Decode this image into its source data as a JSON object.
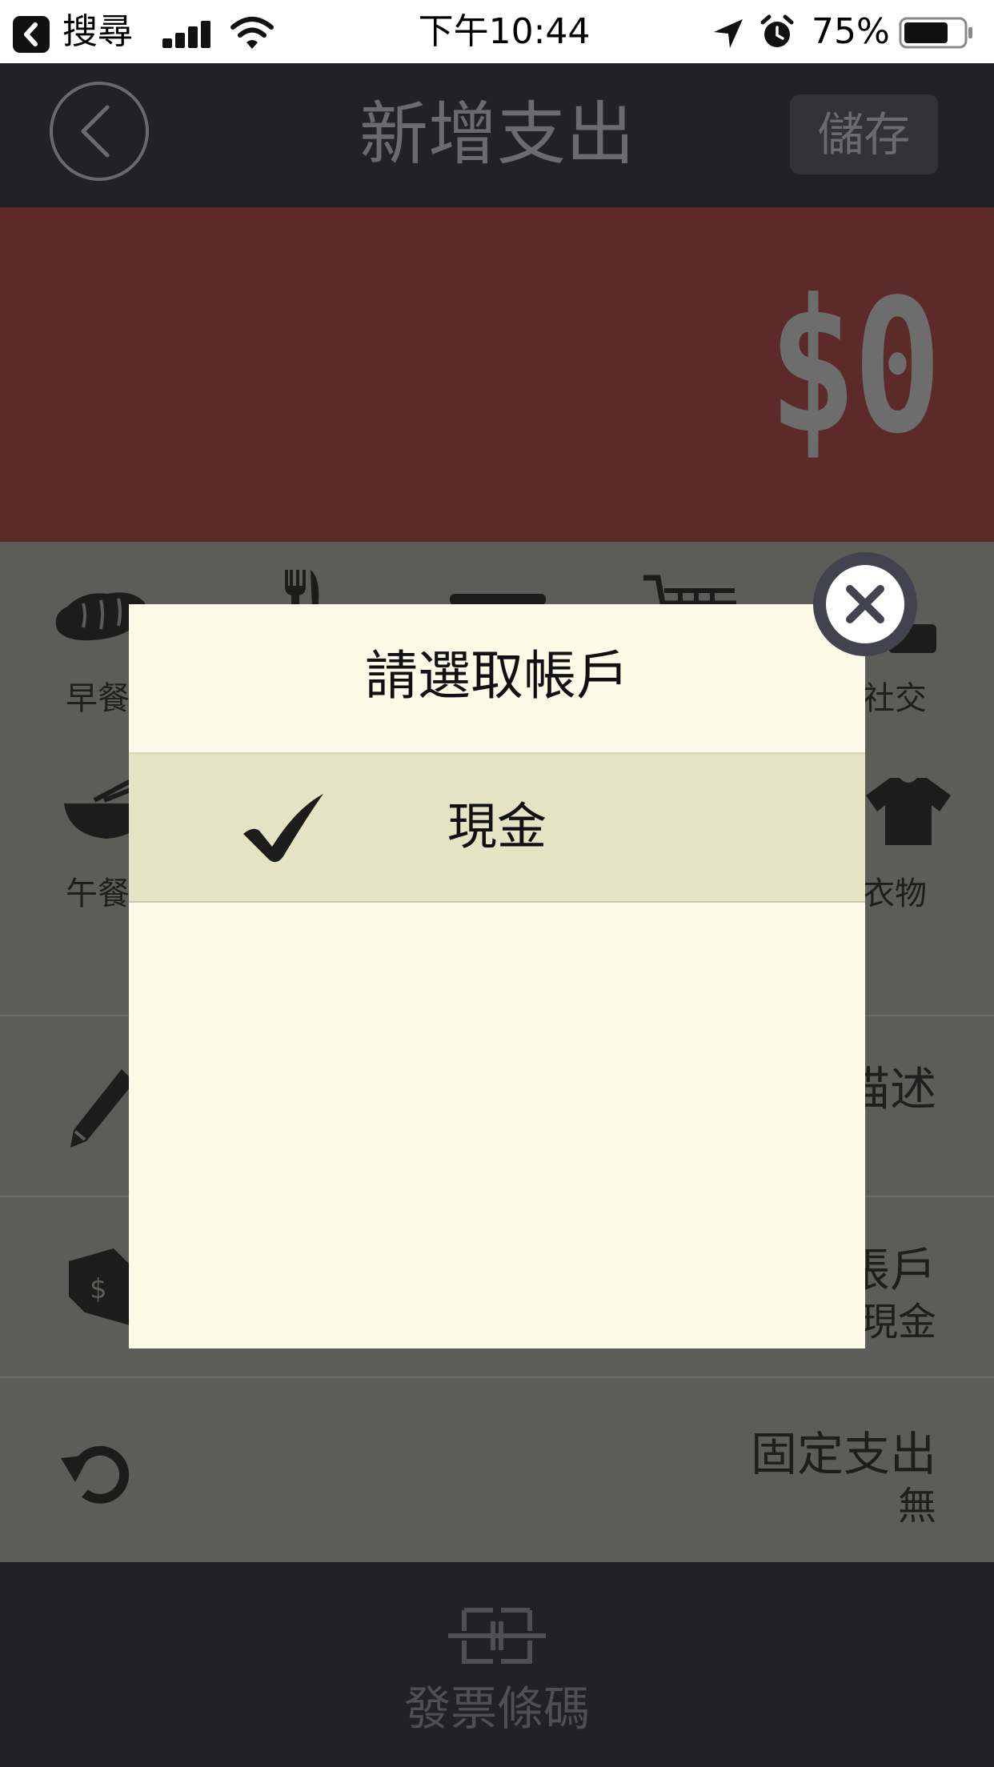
{
  "status_bar": {
    "back_app": "搜尋",
    "time": "下午10:44",
    "battery_percent": "75%",
    "battery_level": 0.75,
    "icons": [
      "signal-icon",
      "wifi-icon",
      "location-icon",
      "alarm-icon",
      "battery-icon"
    ]
  },
  "nav": {
    "title": "新增支出",
    "save_label": "儲存",
    "back_icon": "chevron-left-icon"
  },
  "amount": {
    "value": "$0",
    "background_color": "#5b2a29"
  },
  "categories": [
    {
      "label": "早餐",
      "icon": "bread-icon"
    },
    {
      "label": "",
      "icon": "fork-icon"
    },
    {
      "label": "",
      "icon": "game-icon"
    },
    {
      "label": "",
      "icon": "cart-icon"
    },
    {
      "label": "社交",
      "icon": "social-icon"
    },
    {
      "label": "午餐",
      "icon": "noodle-bowl-icon"
    },
    {
      "label": "衣物",
      "icon": "shirt-icon"
    }
  ],
  "rows": {
    "description": {
      "title": "描述",
      "icon": "pencil-icon"
    },
    "account": {
      "title": "帳戶",
      "value": "現金",
      "icon": "wallet-icon"
    },
    "recurring": {
      "title": "固定支出",
      "value": "無",
      "icon": "refresh-icon"
    }
  },
  "bottom": {
    "barcode_label": "發票條碼",
    "icon": "barcode-icon"
  },
  "modal": {
    "title": "請選取帳戶",
    "options": [
      {
        "label": "現金",
        "selected": true
      }
    ],
    "close_icon": "close-icon",
    "background_color": "#fbfbe8",
    "selected_color": "#e4e3c4"
  }
}
